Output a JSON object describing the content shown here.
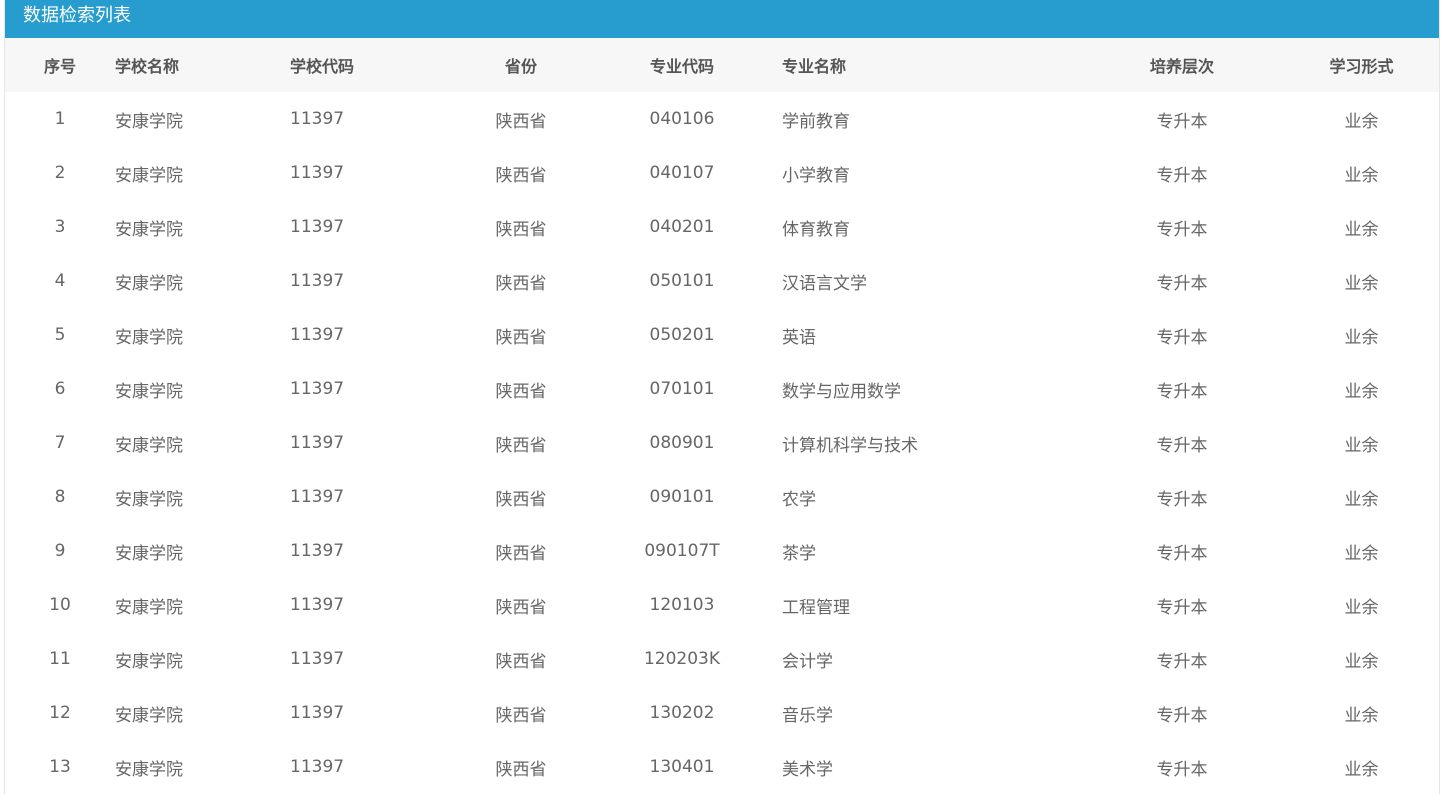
{
  "panel": {
    "title": "数据检索列表"
  },
  "table": {
    "headers": [
      "序号",
      "学校名称",
      "学校代码",
      "省份",
      "专业代码",
      "专业名称",
      "培养层次",
      "学习形式"
    ],
    "rows": [
      [
        "1",
        "安康学院",
        "11397",
        "陕西省",
        "040106",
        "学前教育",
        "专升本",
        "业余"
      ],
      [
        "2",
        "安康学院",
        "11397",
        "陕西省",
        "040107",
        "小学教育",
        "专升本",
        "业余"
      ],
      [
        "3",
        "安康学院",
        "11397",
        "陕西省",
        "040201",
        "体育教育",
        "专升本",
        "业余"
      ],
      [
        "4",
        "安康学院",
        "11397",
        "陕西省",
        "050101",
        "汉语言文学",
        "专升本",
        "业余"
      ],
      [
        "5",
        "安康学院",
        "11397",
        "陕西省",
        "050201",
        "英语",
        "专升本",
        "业余"
      ],
      [
        "6",
        "安康学院",
        "11397",
        "陕西省",
        "070101",
        "数学与应用数学",
        "专升本",
        "业余"
      ],
      [
        "7",
        "安康学院",
        "11397",
        "陕西省",
        "080901",
        "计算机科学与技术",
        "专升本",
        "业余"
      ],
      [
        "8",
        "安康学院",
        "11397",
        "陕西省",
        "090101",
        "农学",
        "专升本",
        "业余"
      ],
      [
        "9",
        "安康学院",
        "11397",
        "陕西省",
        "090107T",
        "茶学",
        "专升本",
        "业余"
      ],
      [
        "10",
        "安康学院",
        "11397",
        "陕西省",
        "120103",
        "工程管理",
        "专升本",
        "业余"
      ],
      [
        "11",
        "安康学院",
        "11397",
        "陕西省",
        "120203K",
        "会计学",
        "专升本",
        "业余"
      ],
      [
        "12",
        "安康学院",
        "11397",
        "陕西省",
        "130202",
        "音乐学",
        "专升本",
        "业余"
      ],
      [
        "13",
        "安康学院",
        "11397",
        "陕西省",
        "130401",
        "美术学",
        "专升本",
        "业余"
      ]
    ]
  },
  "colors": {
    "header_bar": "#269ccf",
    "table_head_bg": "#f7f7f7"
  }
}
